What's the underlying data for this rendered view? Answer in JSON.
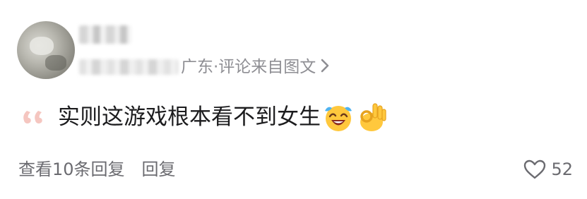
{
  "comment": {
    "location": "广东·评论来自图文",
    "text": "实则这游戏根本看不到女生",
    "emojis": [
      "laughing-crying-emoji",
      "ok-hand-emoji"
    ]
  },
  "footer": {
    "view_replies": "查看10条回复",
    "reply": "回复",
    "like_count": "52"
  },
  "colors": {
    "quote_mark": "#f5c6c0",
    "secondary_text": "#8e8e93",
    "primary_text": "#1c1c1e"
  }
}
